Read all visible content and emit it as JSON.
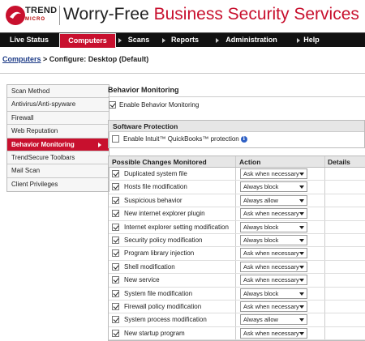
{
  "brand": {
    "name": "TREND",
    "sub": "MICRO"
  },
  "product": {
    "title_a": "Worry-Free",
    "title_b": " Business Security Services"
  },
  "nav": [
    {
      "label": "Live Status",
      "active": false
    },
    {
      "label": "Computers",
      "active": true
    },
    {
      "label": "Scans",
      "active": false
    },
    {
      "label": "Reports",
      "active": false
    },
    {
      "label": "Administration",
      "active": false
    },
    {
      "label": "Help",
      "active": false
    }
  ],
  "breadcrumb": {
    "link": "Computers",
    "sep": " > ",
    "rest": " Configure: Desktop (Default)"
  },
  "sidebar": {
    "items": [
      {
        "label": "Scan Method"
      },
      {
        "label": "Antivirus/Anti-spyware"
      },
      {
        "label": "Firewall"
      },
      {
        "label": "Web Reputation"
      },
      {
        "label": "Behavior Monitoring"
      },
      {
        "label": "TrendSecure Toolbars"
      },
      {
        "label": "Mail Scan"
      },
      {
        "label": "Client Privileges"
      }
    ]
  },
  "main": {
    "title": "Behavior Monitoring",
    "enable_label": "Enable Behavior Monitoring",
    "software_protection": {
      "header": "Software Protection",
      "label": "Enable Intuit™ QuickBooks™ protection"
    },
    "table": {
      "headers": {
        "changes": "Possible Changes Monitored",
        "action": "Action",
        "details": "Details"
      },
      "rows": [
        {
          "name": "Duplicated system file",
          "action": "Ask when necessary"
        },
        {
          "name": "Hosts file modification",
          "action": "Always block"
        },
        {
          "name": "Suspicious behavior",
          "action": "Always allow"
        },
        {
          "name": "New internet explorer plugin",
          "action": "Ask when necessary"
        },
        {
          "name": "Internet explorer setting modification",
          "action": "Always block"
        },
        {
          "name": "Security policy modification",
          "action": "Always block"
        },
        {
          "name": "Program library injection",
          "action": "Ask when necessary"
        },
        {
          "name": "Shell modification",
          "action": "Ask when necessary"
        },
        {
          "name": "New service",
          "action": "Ask when necessary"
        },
        {
          "name": "System file modification",
          "action": "Always block"
        },
        {
          "name": "Firewall policy modification",
          "action": "Ask when necessary"
        },
        {
          "name": "System process modification",
          "action": "Always allow"
        },
        {
          "name": "New startup program",
          "action": "Ask when necessary"
        }
      ]
    }
  },
  "colors": {
    "accent": "#c8102e",
    "nav_bg": "#111111",
    "link": "#1b3a86"
  }
}
